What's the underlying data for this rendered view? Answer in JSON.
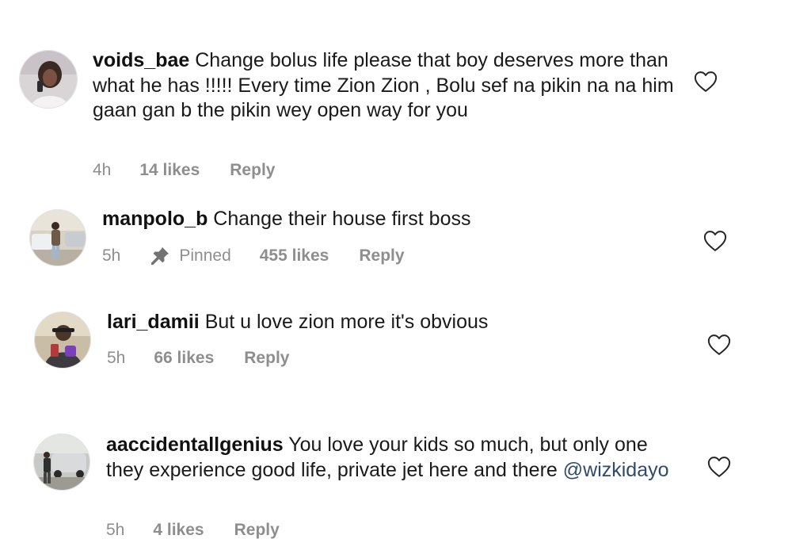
{
  "comments": [
    {
      "username": "voids_bae",
      "text": "Change bolus life please that boy deserves more than what he has !!!!! Every time Zion Zion , Bolu sef na pikin na na him gaan gan b the pikin wey open way for you",
      "time": "4h",
      "likes": "14 likes",
      "reply": "Reply",
      "avatar_icon": "user-avatar"
    },
    {
      "username": "manpolo_b",
      "text": "Change their house first boss",
      "time": "5h",
      "pinned": "Pinned",
      "likes": "455 likes",
      "reply": "Reply",
      "avatar_icon": "user-avatar"
    },
    {
      "username": "lari_damii",
      "text": "But u love zion more it's obvious",
      "time": "5h",
      "likes": "66 likes",
      "reply": "Reply",
      "avatar_icon": "user-avatar"
    },
    {
      "username": "aaccidentallgenius",
      "text": "You love your kids so much, but only one they experience good life, private jet here and there",
      "mention": "@wizkidayo",
      "time": "5h",
      "likes": "4 likes",
      "reply": "Reply",
      "avatar_icon": "user-avatar"
    }
  ],
  "icons": {
    "like": "heart-outline-icon",
    "pin": "pin-icon"
  },
  "colors": {
    "text": "#1a1a1a",
    "meta": "#8e8e8e",
    "mention": "#2f4a6b",
    "heart": "#262626"
  }
}
